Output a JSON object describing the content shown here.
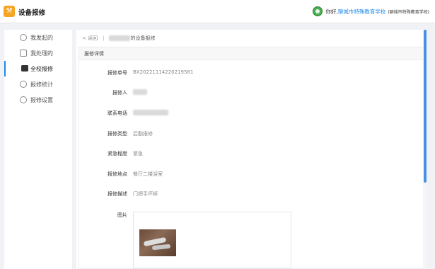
{
  "header": {
    "app_icon": "wrench-hammer-icon",
    "app_title": "设备报修",
    "greeting": "你好,",
    "school_name": "聊城市特殊教育学校",
    "school_paren": "(聊城市特殊教育学校)"
  },
  "sidebar": {
    "items": [
      {
        "label": "我发起的",
        "icon": "person-icon",
        "active": false
      },
      {
        "label": "我处理的",
        "icon": "clipboard-icon",
        "active": false
      },
      {
        "label": "全校报修",
        "icon": "warning-triangle-icon",
        "active": true
      },
      {
        "label": "报修统计",
        "icon": "chart-icon",
        "active": false
      },
      {
        "label": "报修设置",
        "icon": "settings-icon",
        "active": false
      }
    ]
  },
  "breadcrumb": {
    "back": "< 返回",
    "separator": "|",
    "current": "的设备报修"
  },
  "detail": {
    "title": "报修详情",
    "fields": [
      {
        "label": "报修单号",
        "value": "BX20221114220219581"
      },
      {
        "label": "报修人",
        "value": ""
      },
      {
        "label": "联系电话",
        "value": ""
      },
      {
        "label": "报修类型",
        "value": "后勤报修"
      },
      {
        "label": "紧急程度",
        "value": "紧急"
      },
      {
        "label": "报修地点",
        "value": "餐厅二楼浴室"
      },
      {
        "label": "报修描述",
        "value": "门把手坏掉"
      },
      {
        "label": "图片",
        "value": ""
      }
    ]
  },
  "colors": {
    "accent": "#1e88e5",
    "logo": "#f5a623",
    "scrollbar": "#4a90e2"
  }
}
